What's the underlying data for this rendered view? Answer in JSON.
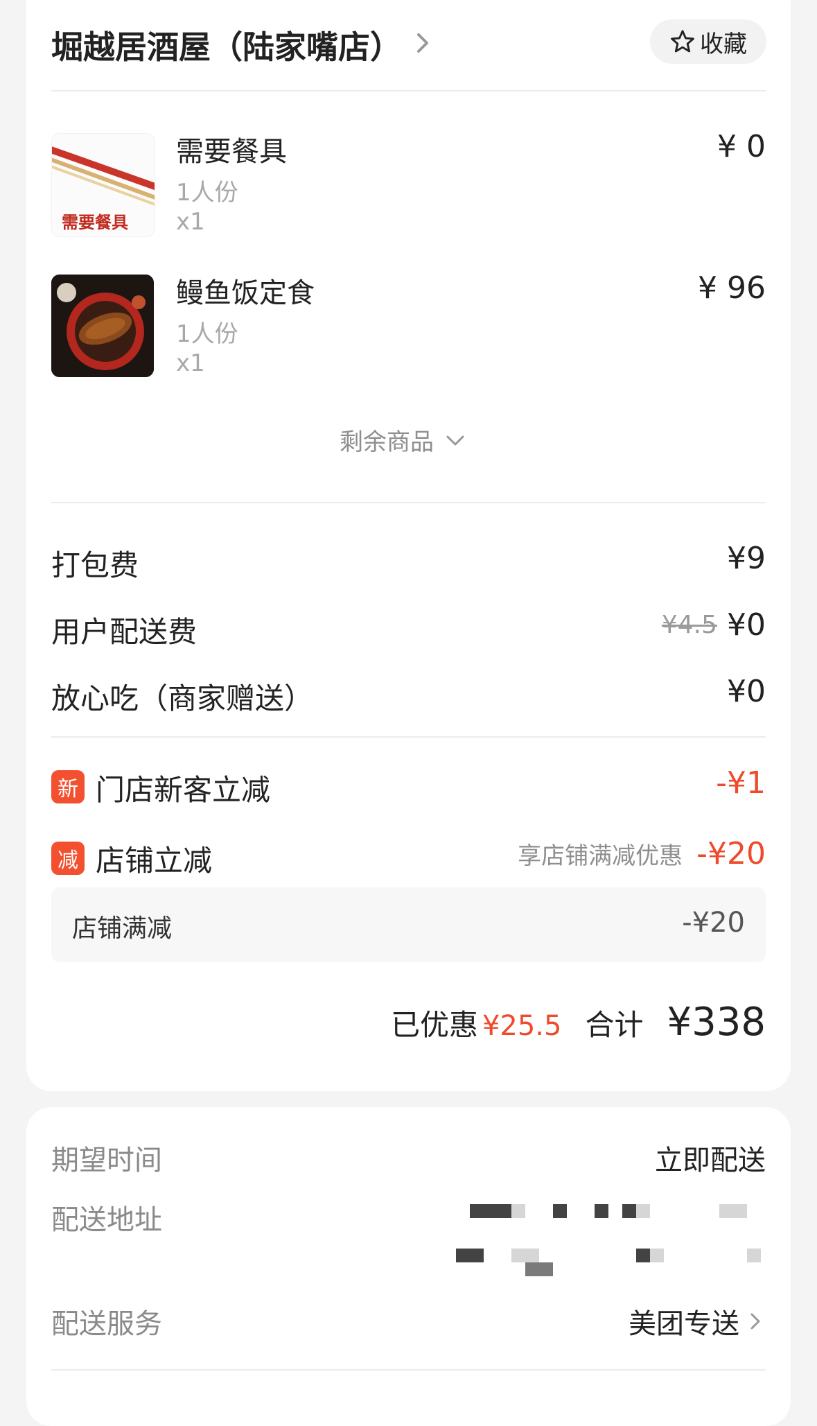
{
  "header": {
    "shop_name": "堀越居酒屋（陆家嘴店）",
    "favorite_label": "收藏"
  },
  "items": [
    {
      "name": "需要餐具",
      "portion": "1人份",
      "qty": "x1",
      "price": "¥ 0",
      "image_text": "需要餐具"
    },
    {
      "name": "鳗鱼饭定食",
      "portion": "1人份",
      "qty": "x1",
      "price": "¥ 96"
    }
  ],
  "more_items_label": "剩余商品",
  "fees": {
    "packing_label": "打包费",
    "packing_value": "¥9",
    "delivery_label": "用户配送费",
    "delivery_original": "¥4.5",
    "delivery_value": "¥0",
    "assurance_label": "放心吃（商家赠送）",
    "assurance_value": "¥0"
  },
  "discounts": {
    "new_customer": {
      "badge": "新",
      "label": "门店新客立减",
      "value": "-¥1"
    },
    "shop": {
      "badge": "减",
      "label": "店铺立减",
      "note": "享店铺满减优惠",
      "value": "-¥20"
    },
    "shop_detail": {
      "label": "店铺满减",
      "value": "-¥20"
    }
  },
  "totals": {
    "saved_label": "已优惠",
    "saved_value": "¥25.5",
    "sum_label": "合计",
    "sum_value": "¥338"
  },
  "delivery": {
    "time_label": "期望时间",
    "time_value": "立即配送",
    "address_label": "配送地址",
    "service_label": "配送服务",
    "service_value": "美团专送"
  },
  "colors": {
    "accent_red": "#ee4b2b",
    "badge_red": "#f2502f",
    "background": "#f4f4f4",
    "card": "#ffffff"
  }
}
